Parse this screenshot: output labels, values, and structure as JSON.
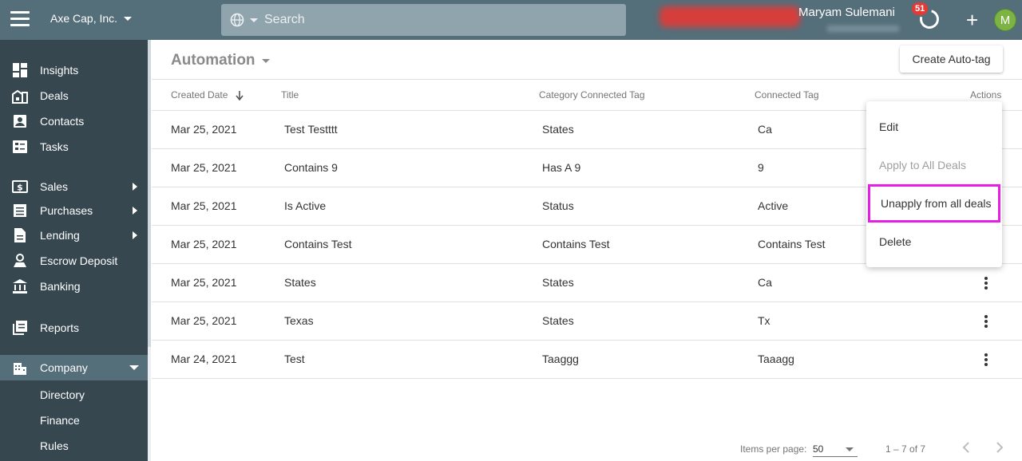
{
  "header": {
    "company": "Axe Cap, Inc.",
    "search_placeholder": "Search",
    "user_name": "Maryam Sulemani",
    "notification_count": "51",
    "avatar_initial": "M",
    "colors": {
      "topbar": "#546e7a",
      "search": "#90a4ae",
      "badge": "#e53935",
      "avatar": "#7cb342"
    }
  },
  "sidebar": {
    "items": [
      {
        "label": "Insights",
        "icon": "insights-icon"
      },
      {
        "label": "Deals",
        "icon": "deals-icon"
      },
      {
        "label": "Contacts",
        "icon": "contacts-icon"
      },
      {
        "label": "Tasks",
        "icon": "tasks-icon"
      },
      {
        "label": "Sales",
        "icon": "sales-icon"
      },
      {
        "label": "Purchases",
        "icon": "purchases-icon"
      },
      {
        "label": "Lending",
        "icon": "lending-icon"
      },
      {
        "label": "Escrow Deposit",
        "icon": "escrow-icon"
      },
      {
        "label": "Banking",
        "icon": "bank-icon"
      },
      {
        "label": "Reports",
        "icon": "reports-icon"
      },
      {
        "label": "Company",
        "icon": "company-icon"
      }
    ],
    "sub_items": [
      {
        "label": "Directory"
      },
      {
        "label": "Finance"
      },
      {
        "label": "Rules"
      }
    ],
    "colors": {
      "background": "#37474f",
      "active": "#546e7a"
    }
  },
  "main": {
    "title": "Automation",
    "create_button": "Create Auto-tag",
    "columns": {
      "created_date": "Created Date",
      "title": "Title",
      "category_tag": "Category Connected Tag",
      "connected_tag": "Connected Tag",
      "actions": "Actions"
    },
    "rows": [
      {
        "date": "Mar 25, 2021",
        "title": "Test Testttt",
        "category": "States",
        "tag": "Ca"
      },
      {
        "date": "Mar 25, 2021",
        "title": "Contains 9",
        "category": "Has A 9",
        "tag": "9"
      },
      {
        "date": "Mar 25, 2021",
        "title": "Is Active",
        "category": "Status",
        "tag": "Active"
      },
      {
        "date": "Mar 25, 2021",
        "title": "Contains Test",
        "category": "Contains Test",
        "tag": "Contains Test"
      },
      {
        "date": "Mar 25, 2021",
        "title": "States",
        "category": "States",
        "tag": "Ca"
      },
      {
        "date": "Mar 25, 2021",
        "title": "Texas",
        "category": "States",
        "tag": "Tx"
      },
      {
        "date": "Mar 24, 2021",
        "title": "Test",
        "category": "Taaggg",
        "tag": "Taaagg"
      }
    ],
    "menu": {
      "edit": "Edit",
      "apply_all": "Apply to All Deals",
      "unapply_all": "Unapply from all deals",
      "delete": "Delete",
      "highlight_color": "#e91ee6"
    },
    "footer": {
      "items_per_page_label": "Items per page:",
      "items_per_page_value": "50",
      "range": "1 – 7 of 7"
    }
  }
}
